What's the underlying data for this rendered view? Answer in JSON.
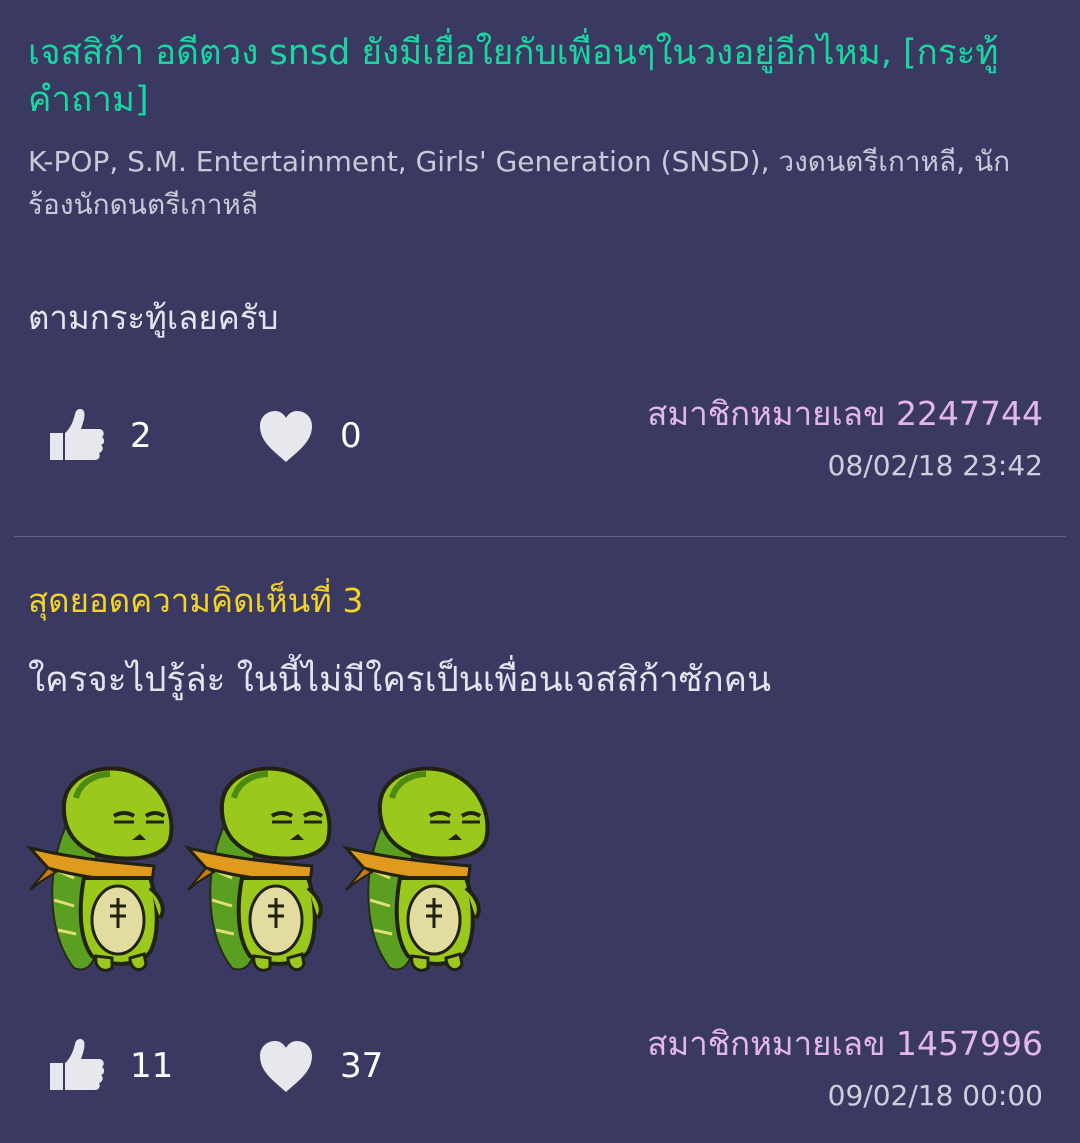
{
  "topic": {
    "title": "เจสสิก้า อดีตวง snsd ยังมีเยื่อใยกับเพื่อนๆในวงอยู่อีกไหม, [กระทู้คำถาม]",
    "tags": "K-POP, S.M. Entertainment, Girls' Generation (SNSD), วงดนตรีเกาหลี, นักร้องนักดนตรีเกาหลี",
    "body": "ตามกระทู้เลยครับ",
    "likes": "2",
    "loves": "0",
    "member": "สมาชิกหมายเลข 2247744",
    "timestamp": "08/02/18 23:42"
  },
  "comment": {
    "heading": "สุดยอดความคิดเห็นที่ 3",
    "body": "ใครจะไปรู้ล่ะ ในนี้ไม่มีใครเป็นเพื่อนเจสสิก้าซักคน",
    "sticker_count": 3,
    "likes": "11",
    "loves": "37",
    "member": "สมาชิกหมายเลข 1457996",
    "timestamp": "09/02/18 00:00"
  },
  "icons": {
    "like": "thumbs-up-icon",
    "love": "heart-icon",
    "sticker": "green-turtle-sticker"
  },
  "colors": {
    "background": "#393961",
    "title": "#1ad6a0",
    "best_comment_heading": "#f2d326",
    "member": "#e3b8e7",
    "icon": "#e7e7ee"
  }
}
